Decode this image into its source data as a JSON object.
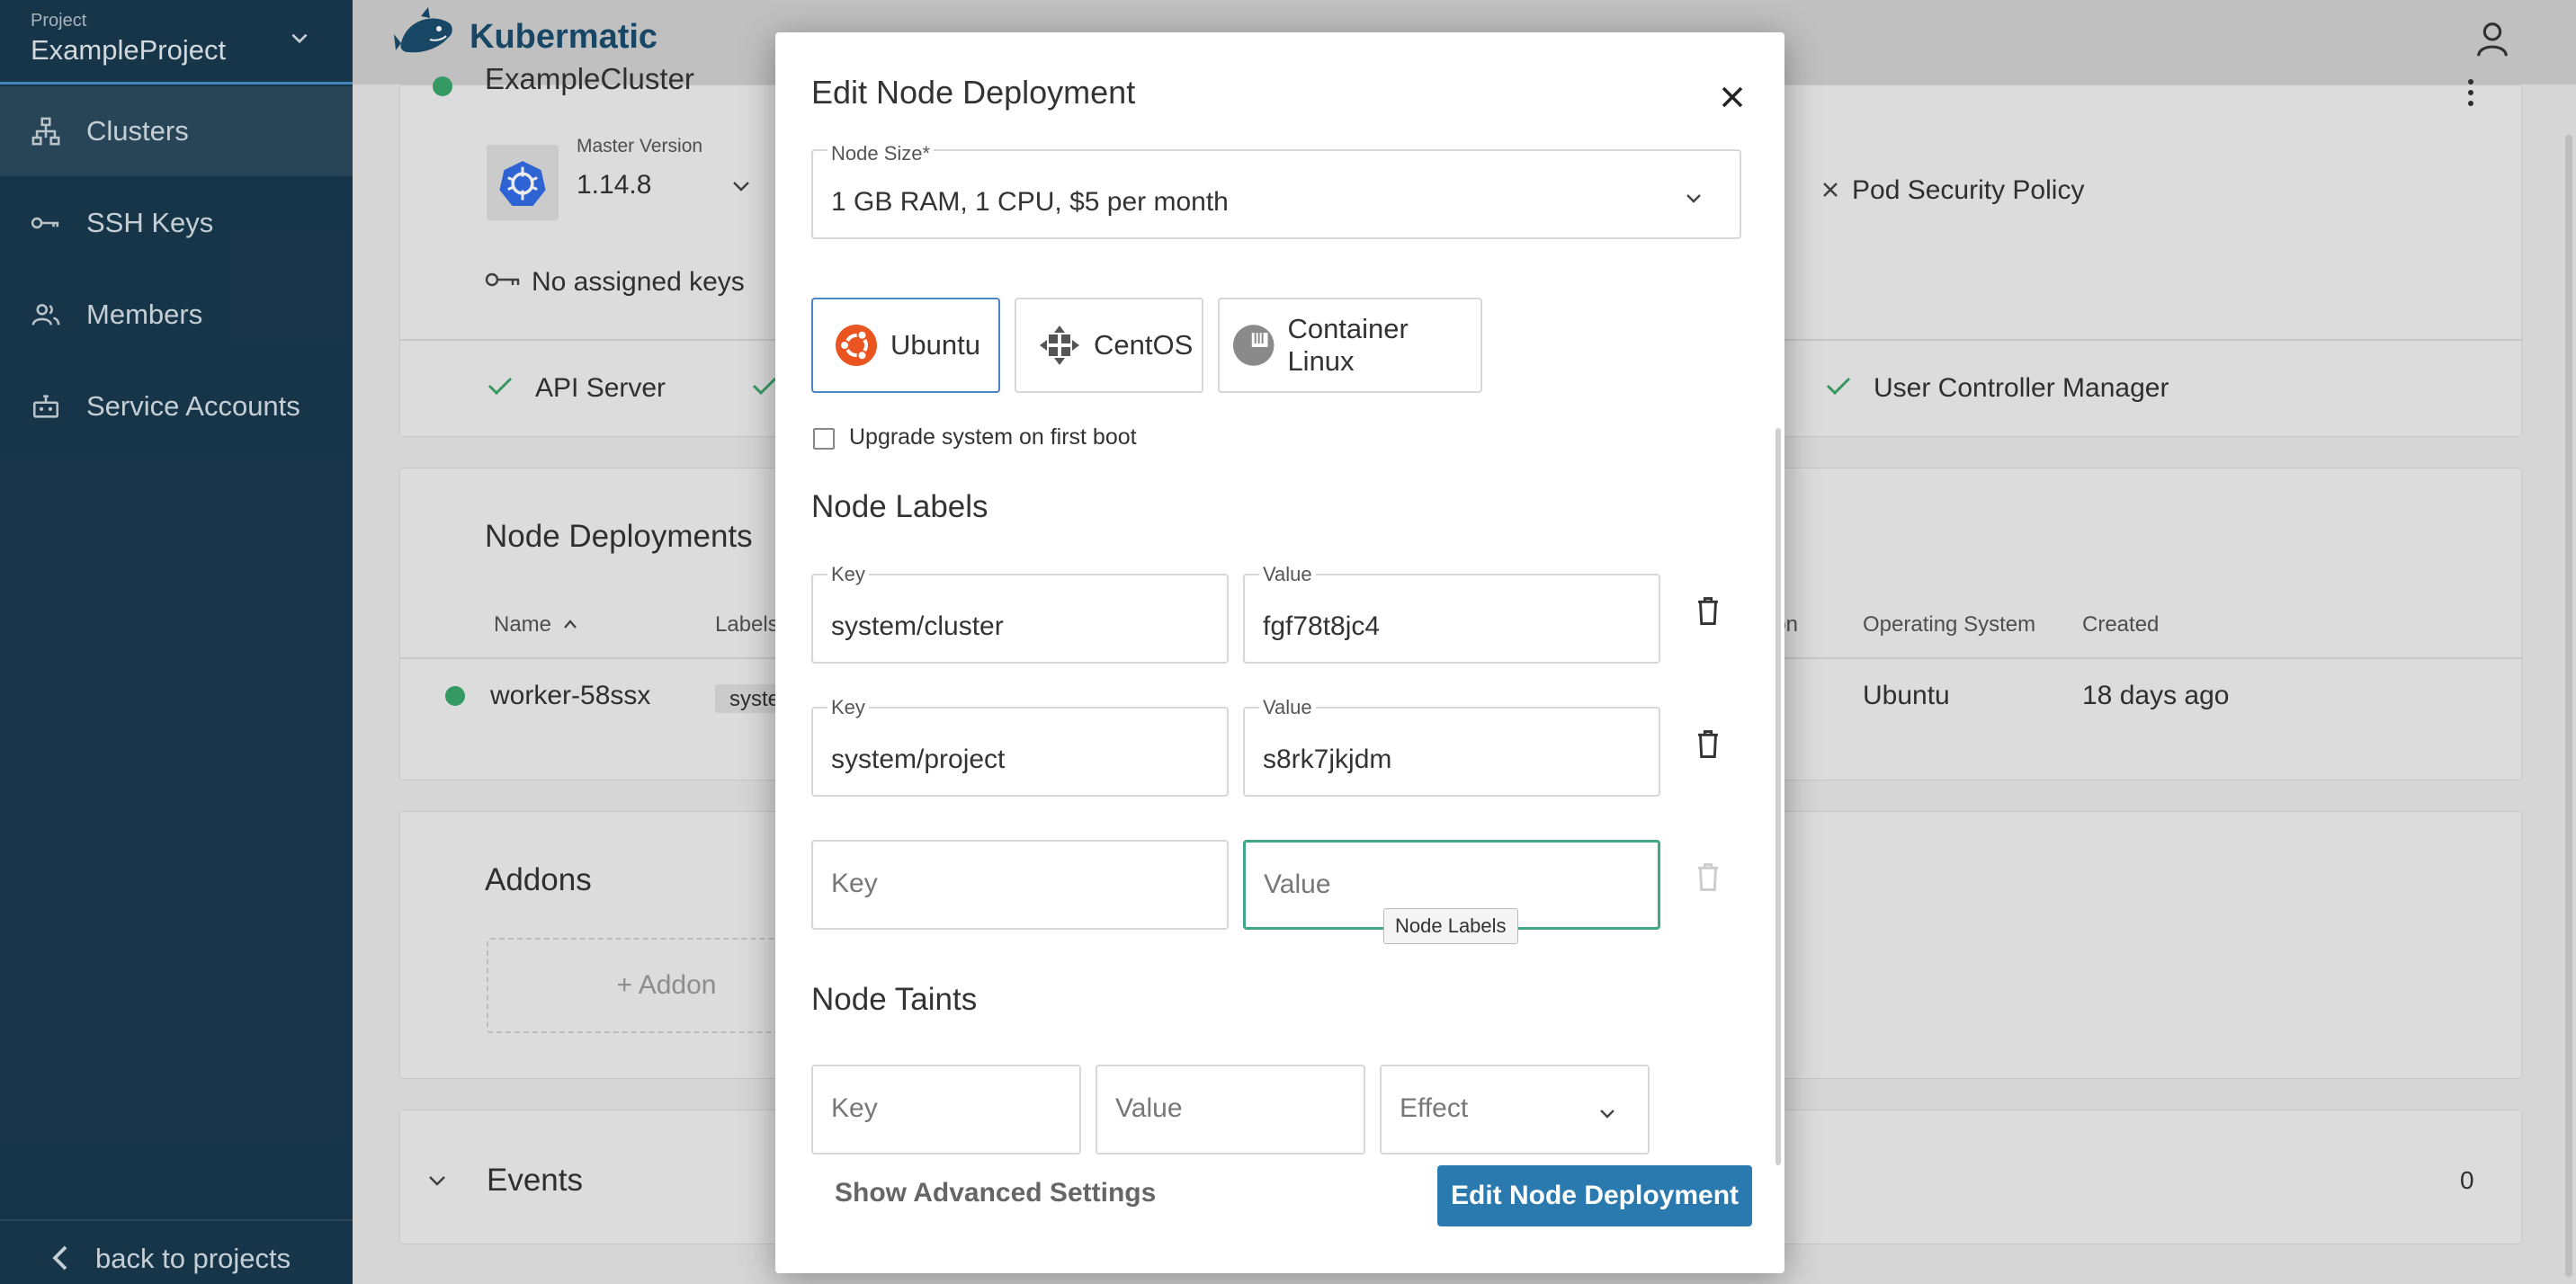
{
  "sidebar": {
    "project_label": "Project",
    "project_name": "ExampleProject",
    "items": [
      {
        "label": "Clusters",
        "icon": "sitemap-icon"
      },
      {
        "label": "SSH Keys",
        "icon": "key-icon"
      },
      {
        "label": "Members",
        "icon": "people-icon"
      },
      {
        "label": "Service Accounts",
        "icon": "robot-icon"
      }
    ],
    "back_label": "back to projects"
  },
  "topbar": {
    "brand": "Kubermatic"
  },
  "cluster": {
    "name": "ExampleCluster",
    "master_version_label": "Master Version",
    "master_version": "1.14.8",
    "no_keys": "No assigned keys",
    "pod_security_policy": "Pod Security Policy",
    "health": [
      {
        "label": "API Server"
      },
      {
        "label": "User Controller Manager"
      }
    ]
  },
  "node_deployments": {
    "title": "Node Deployments",
    "columns": {
      "name": "Name",
      "labels": "Labels",
      "version_partial": "sion",
      "os": "Operating System",
      "created": "Created"
    },
    "rows": [
      {
        "name": "worker-58ssx",
        "label_chip": "syste",
        "os": "Ubuntu",
        "created": "18 days ago"
      }
    ]
  },
  "addons": {
    "title": "Addons",
    "add_button": "+ Addon"
  },
  "events": {
    "title": "Events",
    "count": "0"
  },
  "dialog": {
    "title": "Edit Node Deployment",
    "node_size_label": "Node Size*",
    "node_size_value": "1 GB RAM, 1 CPU, $5 per month",
    "os_options": [
      {
        "name": "Ubuntu",
        "selected": true
      },
      {
        "name": "CentOS",
        "selected": false
      },
      {
        "name": "Container Linux",
        "selected": false
      }
    ],
    "upgrade_label": "Upgrade system on first boot",
    "labels_title": "Node Labels",
    "labels": [
      {
        "key_label": "Key",
        "key": "system/cluster",
        "value_label": "Value",
        "value": "fgf78t8jc4"
      },
      {
        "key_label": "Key",
        "key": "system/project",
        "value_label": "Value",
        "value": "s8rk7jkjdm"
      }
    ],
    "new_label_key_placeholder": "Key",
    "new_label_value_placeholder": "Value",
    "tooltip": "Node Labels",
    "taints_title": "Node Taints",
    "taint_key_placeholder": "Key",
    "taint_value_placeholder": "Value",
    "taint_effect_placeholder": "Effect",
    "advanced_button": "Show Advanced Settings",
    "submit_button": "Edit Node Deployment"
  },
  "colors": {
    "sidebar": "#1a3a4f",
    "primary": "#2a7ab0",
    "focus": "#3ea888",
    "ok": "#3aa76d"
  }
}
